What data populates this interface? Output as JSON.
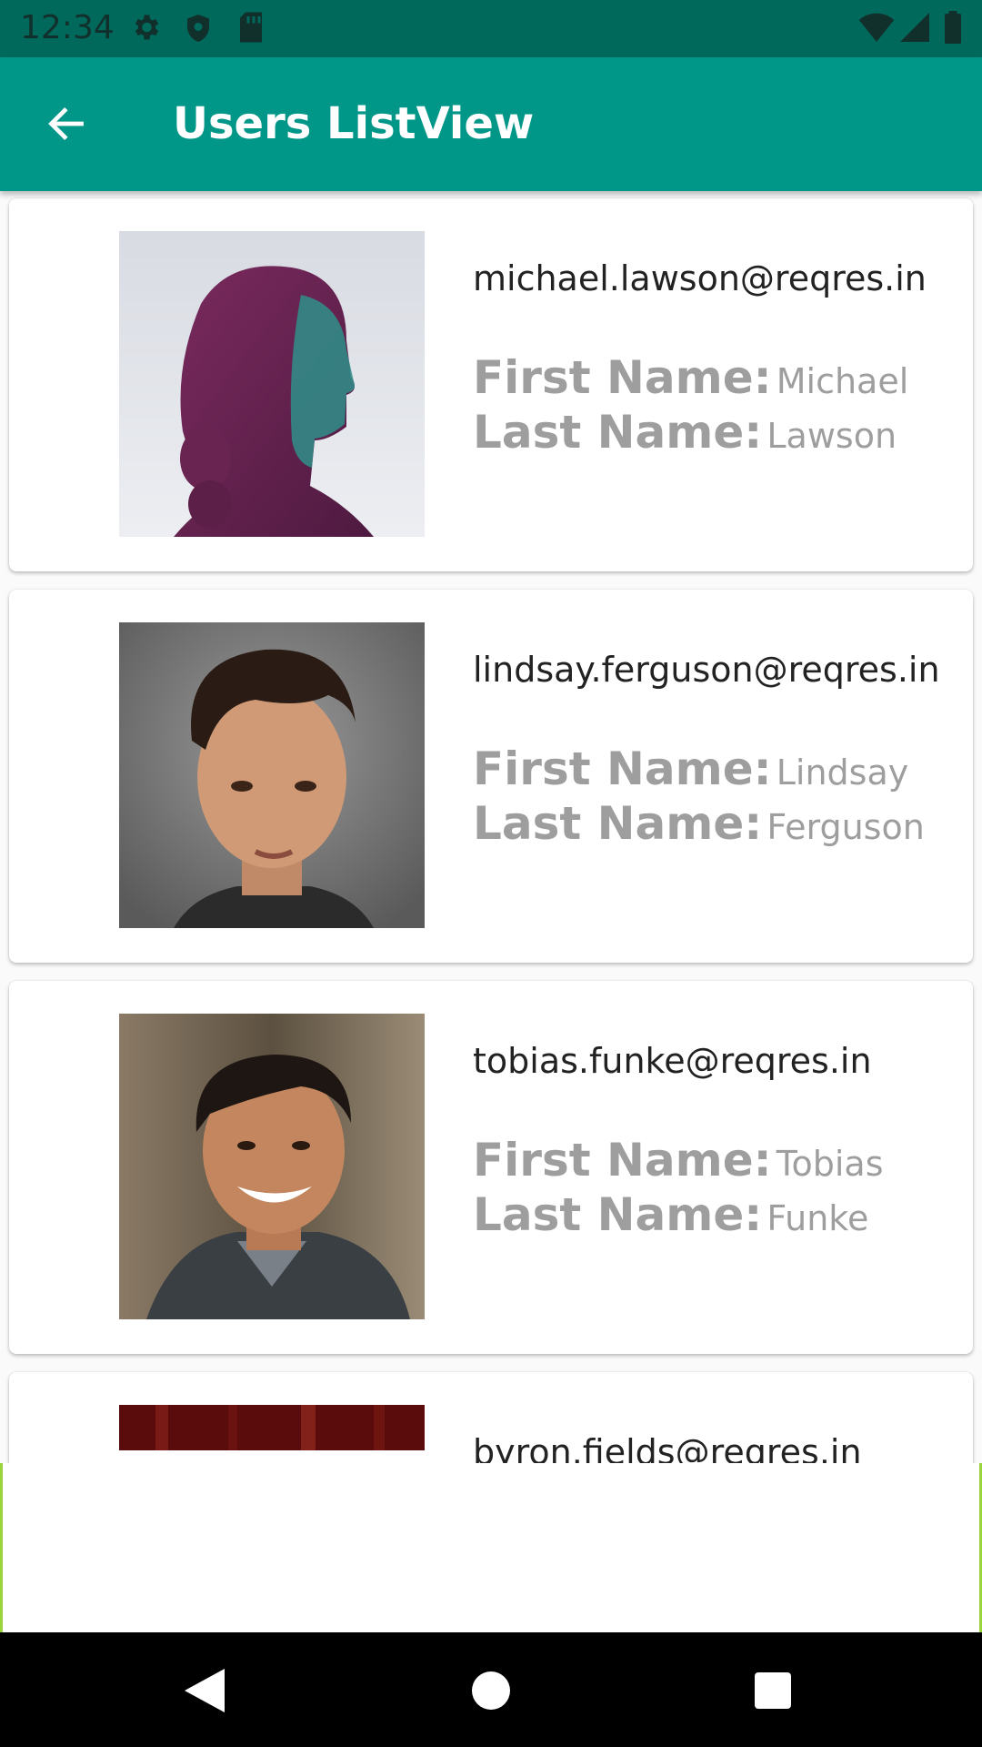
{
  "status_bar": {
    "time": "12:34",
    "icons": [
      "gear-icon",
      "shield-icon",
      "sd-card-icon",
      "wifi-icon",
      "signal-icon",
      "battery-icon"
    ]
  },
  "app_bar": {
    "title": "Users ListView",
    "back_icon": "arrow-left-icon"
  },
  "users": [
    {
      "email": "michael.lawson@reqres.in",
      "first_label": "First Name:",
      "first_name": "Michael",
      "last_label": "Last Name:",
      "last_name": "Lawson"
    },
    {
      "email": "lindsay.ferguson@reqres.in",
      "first_label": "First Name:",
      "first_name": "Lindsay",
      "last_label": "Last Name:",
      "last_name": "Ferguson"
    },
    {
      "email": "tobias.funke@reqres.in",
      "first_label": "First Name:",
      "first_name": "Tobias",
      "last_label": "Last Name:",
      "last_name": "Funke"
    },
    {
      "email": "byron.fields@reqres.in"
    }
  ],
  "colors": {
    "status_bar": "#00695c",
    "app_bar": "#009688",
    "label": "#9e9e9e"
  }
}
